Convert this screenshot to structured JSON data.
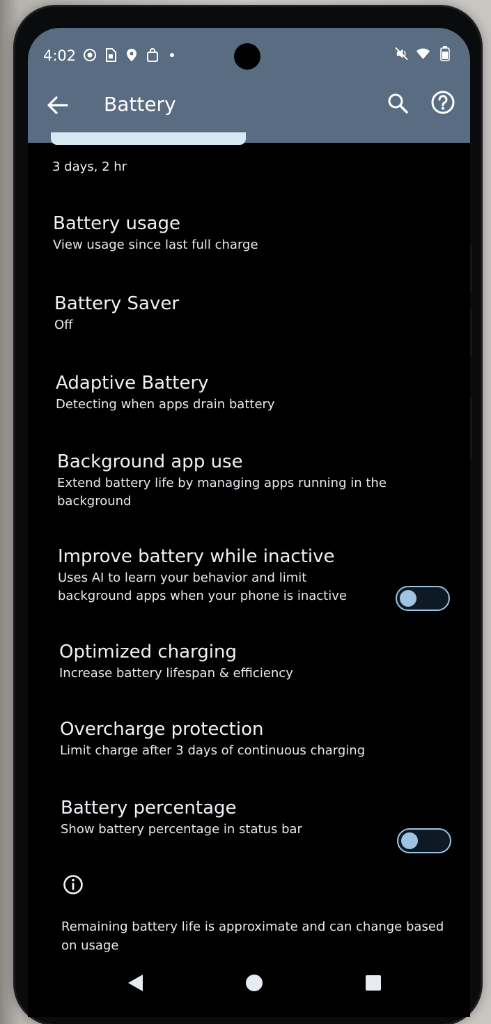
{
  "status_bar": {
    "time": "4:02",
    "icons": [
      "whatsapp-icon",
      "sim-icon",
      "maps-icon",
      "shopping-icon",
      "more-dot-icon"
    ],
    "right_icons": [
      "mute-icon",
      "wifi-icon",
      "battery-icon"
    ]
  },
  "header": {
    "title": "Battery",
    "back_icon": "arrow-left-icon",
    "search_icon": "search-icon",
    "help_icon": "help-icon"
  },
  "battery": {
    "remaining": "3 days, 2 hr",
    "level_fraction": 0.5
  },
  "items": [
    {
      "title": "Battery usage",
      "subtitle": "View usage since last full charge"
    },
    {
      "title": "Battery Saver",
      "subtitle": "Off"
    },
    {
      "title": "Adaptive Battery",
      "subtitle": "Detecting when apps drain battery"
    },
    {
      "title": "Background app use",
      "subtitle": "Extend battery life by managing apps running in the background"
    },
    {
      "title": "Improve battery while inactive",
      "subtitle": "Uses AI to learn your behavior and limit background apps when your phone is inactive",
      "toggle": false
    },
    {
      "title": "Optimized charging",
      "subtitle": "Increase battery lifespan & efficiency"
    },
    {
      "title": "Overcharge protection",
      "subtitle": "Limit charge after 3 days of continuous charging"
    },
    {
      "title": "Battery percentage",
      "subtitle": "Show battery percentage in status bar",
      "toggle": false
    }
  ],
  "footer": {
    "info_icon": "info-icon",
    "note": "Remaining battery life is approximate and can change based on usage"
  },
  "nav": {
    "back_icon": "nav-back-icon",
    "home_icon": "nav-home-icon",
    "recents_icon": "nav-recents-icon"
  },
  "colors": {
    "app_bar": "#5a6c82",
    "accent": "#9ec4e2",
    "background": "#000000"
  }
}
